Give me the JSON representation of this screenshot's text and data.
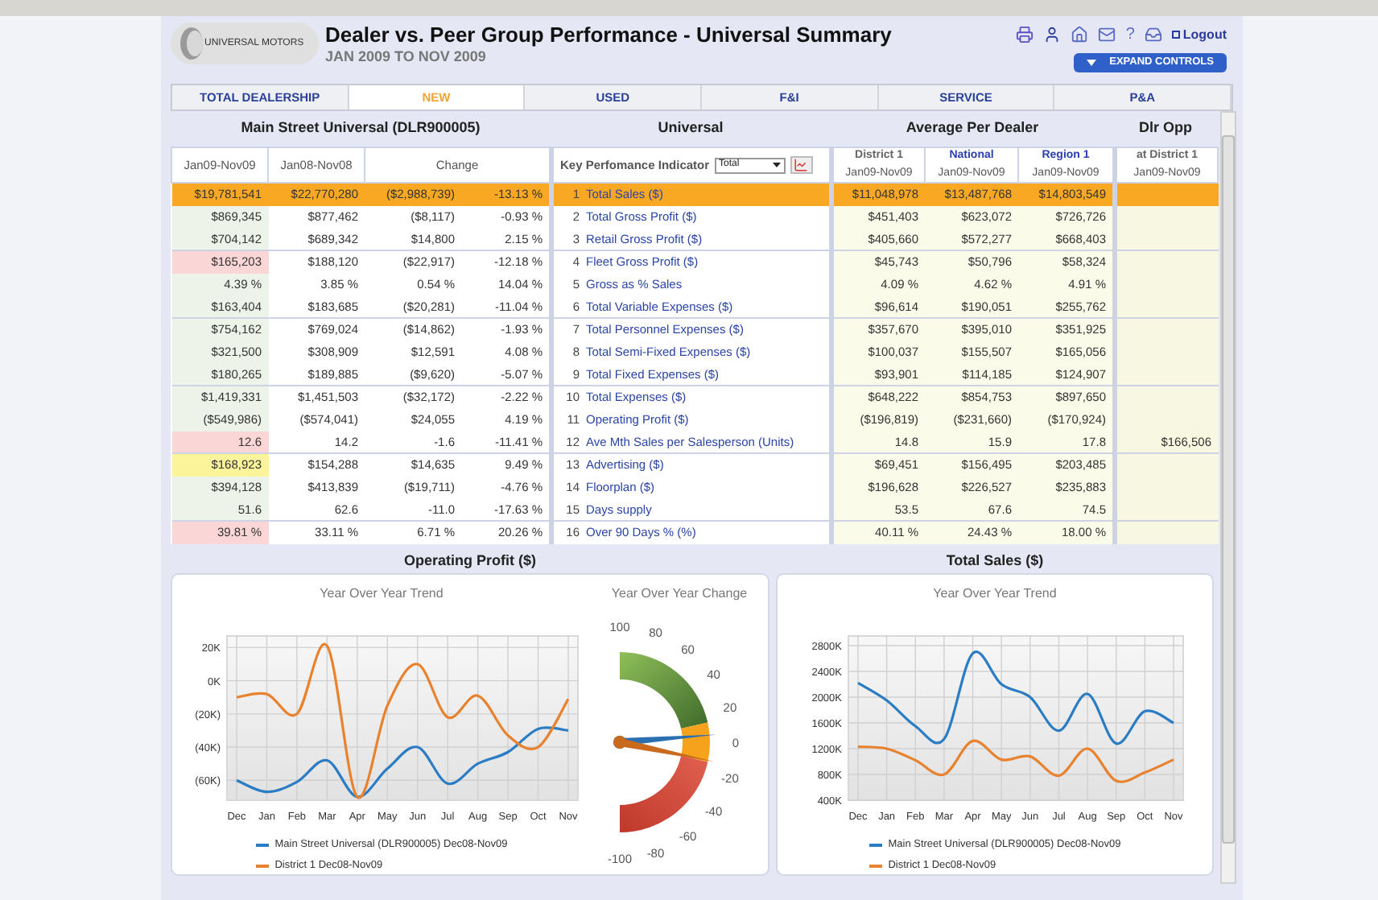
{
  "header": {
    "logo_text": "UNIVERSAL MOTORS",
    "title": "Dealer vs. Peer Group Performance - Universal Summary",
    "subtitle": "JAN 2009 TO NOV 2009",
    "help": "?",
    "logout": "Logout",
    "expand_button": "EXPAND CONTROLS"
  },
  "tabs": [
    {
      "label": "TOTAL DEALERSHIP",
      "selected": false
    },
    {
      "label": "NEW",
      "selected": true
    },
    {
      "label": "USED",
      "selected": false
    },
    {
      "label": "F&I",
      "selected": false
    },
    {
      "label": "SERVICE",
      "selected": false
    },
    {
      "label": "P&A",
      "selected": false
    }
  ],
  "section_headings": [
    "Main Street Universal (DLR900005)",
    "Universal",
    "Average Per Dealer",
    "Dlr Opp"
  ],
  "table": {
    "dealer_columns": [
      "Jan09-Nov09",
      "Jan08-Nov08",
      "Change"
    ],
    "kpi_header": "Key Perfomance Indicator",
    "kpi_select": "Total",
    "peer_columns": [
      {
        "name": "District 1",
        "period": "Jan09-Nov09",
        "kind": "plain"
      },
      {
        "name": "National",
        "period": "Jan09-Nov09",
        "kind": "link"
      },
      {
        "name": "Region 1",
        "period": "Jan09-Nov09",
        "kind": "link"
      }
    ],
    "opp_column": {
      "name": "at District 1",
      "period": "Jan09-Nov09"
    },
    "row_groups": [
      {
        "rows": [
          {
            "num": "1",
            "kpi": "Total Sales ($)",
            "dealer": [
              "$19,781,541",
              "$22,770,280",
              "($2,988,739)",
              "-13.13 %"
            ],
            "peer": [
              "$11,048,978",
              "$13,487,768",
              "$14,803,549"
            ],
            "selected": true
          },
          {
            "num": "2",
            "kpi": "Total Gross Profit ($)",
            "dealer": [
              "$869,345",
              "$877,462",
              "($8,117)",
              "-0.93 %"
            ],
            "peer": [
              "$451,403",
              "$623,072",
              "$726,726"
            ],
            "selected": false,
            "color": "#edf3e8"
          },
          {
            "num": "3",
            "kpi": "Retail Gross Profit ($)",
            "dealer": [
              "$704,142",
              "$689,342",
              "$14,800",
              "2.15 %"
            ],
            "peer": [
              "$405,660",
              "$572,277",
              "$668,403"
            ],
            "selected": false,
            "color": "#edf3e8"
          }
        ]
      },
      {
        "rows": [
          {
            "num": "4",
            "kpi": "Fleet Gross Profit ($)",
            "dealer": [
              "$165,203",
              "$188,120",
              "($22,917)",
              "-12.18 %"
            ],
            "peer": [
              "$45,743",
              "$50,796",
              "$58,324"
            ],
            "selected": false,
            "color": "#fad6d6"
          },
          {
            "num": "5",
            "kpi": "Gross as % Sales",
            "dealer": [
              "4.39 %",
              "3.85 %",
              "0.54 %",
              "14.04 %"
            ],
            "peer": [
              "4.09 %",
              "4.62 %",
              "4.91 %"
            ],
            "selected": false,
            "color": "#edf3e8"
          },
          {
            "num": "6",
            "kpi": "Total Variable Expenses ($)",
            "dealer": [
              "$163,404",
              "$183,685",
              "($20,281)",
              "-11.04 %"
            ],
            "peer": [
              "$96,614",
              "$190,051",
              "$255,762"
            ],
            "selected": false,
            "color": "#edf3e8"
          }
        ]
      },
      {
        "rows": [
          {
            "num": "7",
            "kpi": "Total Personnel Expenses ($)",
            "dealer": [
              "$754,162",
              "$769,024",
              "($14,862)",
              "-1.93 %"
            ],
            "peer": [
              "$357,670",
              "$395,010",
              "$351,925"
            ],
            "selected": false,
            "color": "#edf3e8"
          },
          {
            "num": "8",
            "kpi": "Total Semi-Fixed Expenses ($)",
            "dealer": [
              "$321,500",
              "$308,909",
              "$12,591",
              "4.08 %"
            ],
            "peer": [
              "$100,037",
              "$155,507",
              "$165,056"
            ],
            "selected": false,
            "color": "#edf3e8"
          },
          {
            "num": "9",
            "kpi": "Total Fixed Expenses ($)",
            "dealer": [
              "$180,265",
              "$189,885",
              "($9,620)",
              "-5.07 %"
            ],
            "peer": [
              "$93,901",
              "$114,185",
              "$124,907"
            ],
            "selected": false,
            "color": "#edf3e8"
          }
        ]
      },
      {
        "rows": [
          {
            "num": "10",
            "kpi": "Total Expenses ($)",
            "dealer": [
              "$1,419,331",
              "$1,451,503",
              "($32,172)",
              "-2.22 %"
            ],
            "peer": [
              "$648,222",
              "$854,753",
              "$897,650"
            ],
            "selected": false,
            "color": "#edf3e8"
          },
          {
            "num": "11",
            "kpi": "Operating Profit ($)",
            "dealer": [
              "($549,986)",
              "($574,041)",
              "$24,055",
              "4.19 %"
            ],
            "peer": [
              "($196,819)",
              "($231,660)",
              "($170,924)"
            ],
            "selected": false,
            "color": "#edf3e8"
          },
          {
            "num": "12",
            "kpi": "Ave Mth Sales per Salesperson (Units)",
            "dealer": [
              "12.6",
              "14.2",
              "-1.6",
              "-11.41 %"
            ],
            "peer": [
              "14.8",
              "15.9",
              "17.8"
            ],
            "opp": "$166,506",
            "selected": false,
            "color": "#fad6d6"
          }
        ]
      },
      {
        "rows": [
          {
            "num": "13",
            "kpi": "Advertising ($)",
            "dealer": [
              "$168,923",
              "$154,288",
              "$14,635",
              "9.49 %"
            ],
            "peer": [
              "$69,451",
              "$156,495",
              "$203,485"
            ],
            "selected": false,
            "color": "#fbf49a"
          },
          {
            "num": "14",
            "kpi": "Floorplan ($)",
            "dealer": [
              "$394,128",
              "$413,839",
              "($19,711)",
              "-4.76 %"
            ],
            "peer": [
              "$196,628",
              "$226,527",
              "$235,883"
            ],
            "selected": false,
            "color": "#edf3e8"
          },
          {
            "num": "15",
            "kpi": "Days supply",
            "dealer": [
              "51.6",
              "62.6",
              "-11.0",
              "-17.63 %"
            ],
            "peer": [
              "53.5",
              "67.6",
              "74.5"
            ],
            "selected": false,
            "color": "#edf3e8"
          }
        ]
      },
      {
        "rows": [
          {
            "num": "16",
            "kpi": "Over 90 Days % (%)",
            "dealer": [
              "39.81 %",
              "33.11 %",
              "6.71 %",
              "20.26 %"
            ],
            "peer": [
              "40.11 %",
              "24.43 %",
              "18.00 %"
            ],
            "selected": false,
            "color": "#fad6d6"
          }
        ]
      }
    ]
  },
  "operating_profit": {
    "heading": "Operating Profit ($)",
    "chart_data": {
      "type": "line",
      "title": "Year Over Year Trend",
      "grid": true,
      "legend": true,
      "categories": [
        "Dec",
        "Jan",
        "Feb",
        "Mar",
        "Apr",
        "May",
        "Jun",
        "Jul",
        "Aug",
        "Sep",
        "Oct",
        "Nov"
      ],
      "series": [
        {
          "name": "Main Street Universal (DLR900005) Dec08-Nov09",
          "color": "#2a7dc4",
          "values": [
            -60,
            -67,
            -61,
            -48,
            -70,
            -53,
            -40,
            -62,
            -50,
            -43,
            -29,
            -30
          ]
        },
        {
          "name": "District 1 Dec08-Nov09",
          "color": "#e8822e",
          "values": [
            -10,
            -8,
            -20,
            21,
            -70,
            -15,
            10,
            -22,
            -9,
            -33,
            -40,
            -11
          ]
        }
      ],
      "ylim": [
        -72,
        27
      ],
      "yticks": [
        {
          "value": 20,
          "label": "20K"
        },
        {
          "value": 0,
          "label": "0K"
        },
        {
          "value": -20,
          "label": "(20K)"
        },
        {
          "value": -40,
          "label": "(40K)"
        },
        {
          "value": -60,
          "label": "(60K)"
        }
      ]
    },
    "gauge": {
      "title": "Year Over Year Change",
      "ticks": [
        "100",
        "80",
        "60",
        "40",
        "20",
        "0",
        "-20",
        "-40",
        "-60",
        "-80",
        "-100"
      ],
      "needles": [
        {
          "color": "#2a6fb0"
        },
        {
          "color": "#c96a1c"
        }
      ]
    }
  },
  "total_sales": {
    "heading": "Total Sales ($)",
    "chart_data": {
      "type": "line",
      "title": "Year Over Year Trend",
      "grid": true,
      "legend": true,
      "categories": [
        "Dec",
        "Jan",
        "Feb",
        "Mar",
        "Apr",
        "May",
        "Jun",
        "Jul",
        "Aug",
        "Sep",
        "Oct",
        "Nov"
      ],
      "series": [
        {
          "name": "Main Street Universal (DLR900005) Dec08-Nov09",
          "color": "#2a7dc4",
          "values": [
            2220,
            1950,
            1550,
            1350,
            2680,
            2200,
            2000,
            1480,
            2050,
            1280,
            1780,
            1600
          ]
        },
        {
          "name": "District 1 Dec08-Nov09",
          "color": "#e8822e",
          "values": [
            1230,
            1200,
            1020,
            800,
            1320,
            1030,
            1080,
            780,
            1200,
            700,
            830,
            1030
          ]
        }
      ],
      "ylim": [
        400,
        2950
      ],
      "yticks": [
        {
          "value": 400,
          "label": "400K"
        },
        {
          "value": 800,
          "label": "800K"
        },
        {
          "value": 1200,
          "label": "1200K"
        },
        {
          "value": 1600,
          "label": "1600K"
        },
        {
          "value": 2000,
          "label": "2000K"
        },
        {
          "value": 2400,
          "label": "2400K"
        },
        {
          "value": 2800,
          "label": "2800K"
        }
      ]
    }
  }
}
